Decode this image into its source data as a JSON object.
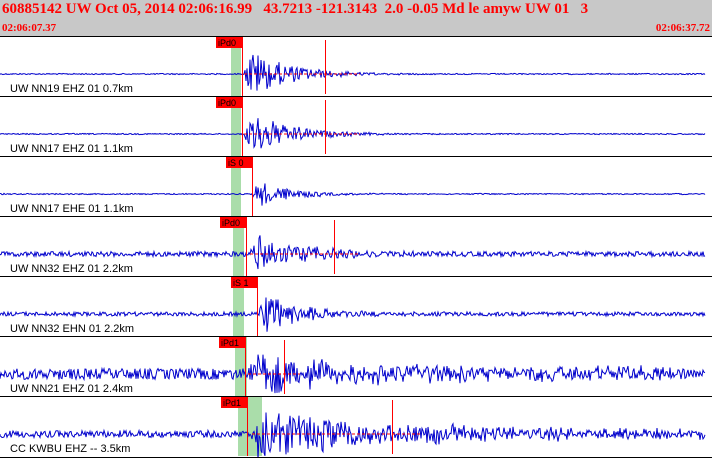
{
  "header": {
    "title": "60885142 UW Oct 05, 2014 02:06:16.99   43.7213 -121.3143  2.0 -0.05 Md le amyw UW 01   3",
    "start_time": "02:06:07.37",
    "end_time": "02:06:37.72",
    "background_color": "#c8c8c8",
    "text_color": "#ff0000"
  },
  "colors": {
    "trace": "#0000cc",
    "pick_line": "#ff0000",
    "pick_label_bg": "#ff0000",
    "window_band": "#aaddaa",
    "dashed_line": "#ff0000"
  },
  "panels": [
    {
      "label": "UW NN19 EHZ 01 0.7km",
      "pick_label": "iPd0",
      "amplitude": "high"
    },
    {
      "label": "UW NN17 EHZ 01 1.1km",
      "pick_label": "iPd0",
      "amplitude": "high"
    },
    {
      "label": "UW NN17 EHE 01 1.1km",
      "pick_label": "iS 0",
      "amplitude": "medium"
    },
    {
      "label": "UW NN32 EHZ 01 2.2km",
      "pick_label": "iPd0",
      "amplitude": "medium"
    },
    {
      "label": "UW NN32 EHN 01 2.2km",
      "pick_label": "iS 1",
      "amplitude": "medium"
    },
    {
      "label": "UW NN21 EHZ 01 2.4km",
      "pick_label": "iPd1",
      "amplitude": "noisy"
    },
    {
      "label": "CC KWBU EHZ -- 3.5km",
      "pick_label": "iPd1",
      "amplitude": "noisy"
    }
  ]
}
